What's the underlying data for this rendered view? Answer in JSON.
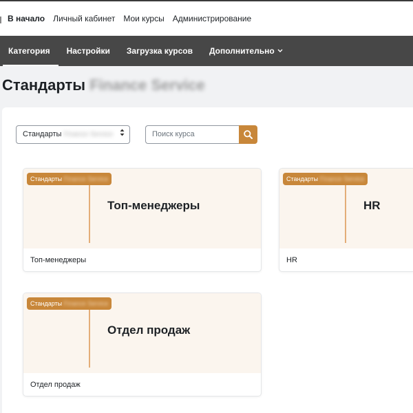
{
  "top_nav": {
    "items": [
      "В начало",
      "Личный кабинет",
      "Мои курсы",
      "Администрирование"
    ]
  },
  "secondary_nav": {
    "tabs": [
      "Категория",
      "Настройки",
      "Загрузка курсов",
      "Дополнительно"
    ]
  },
  "page": {
    "title": "Стандарты",
    "title_obscured": "Finance Service"
  },
  "filters": {
    "category_select": {
      "value": "Стандарты",
      "value_obscured": "Finance Service"
    },
    "search": {
      "placeholder": "Поиск курса"
    }
  },
  "courses": [
    {
      "category": "Стандарты",
      "category_obscured": "Finance Service",
      "image_title": "Топ-менеджеры",
      "name": "Топ-менеджеры"
    },
    {
      "category": "Стандарты",
      "category_obscured": "Finance Service",
      "image_title": "HR",
      "name": "HR"
    },
    {
      "category": "Стандарты",
      "category_obscured": "Finance Service",
      "image_title": "Отдел продаж",
      "name": "Отдел продаж"
    }
  ],
  "colors": {
    "accent": "#c8873a",
    "nav_background": "#474747",
    "card_image_background": "#fbf5ee",
    "card_line": "#e3ad78"
  },
  "icons": {
    "search_button": "search-icon",
    "more_menu": "chevron-down-icon",
    "select_arrow": "sort-arrows-icon"
  }
}
